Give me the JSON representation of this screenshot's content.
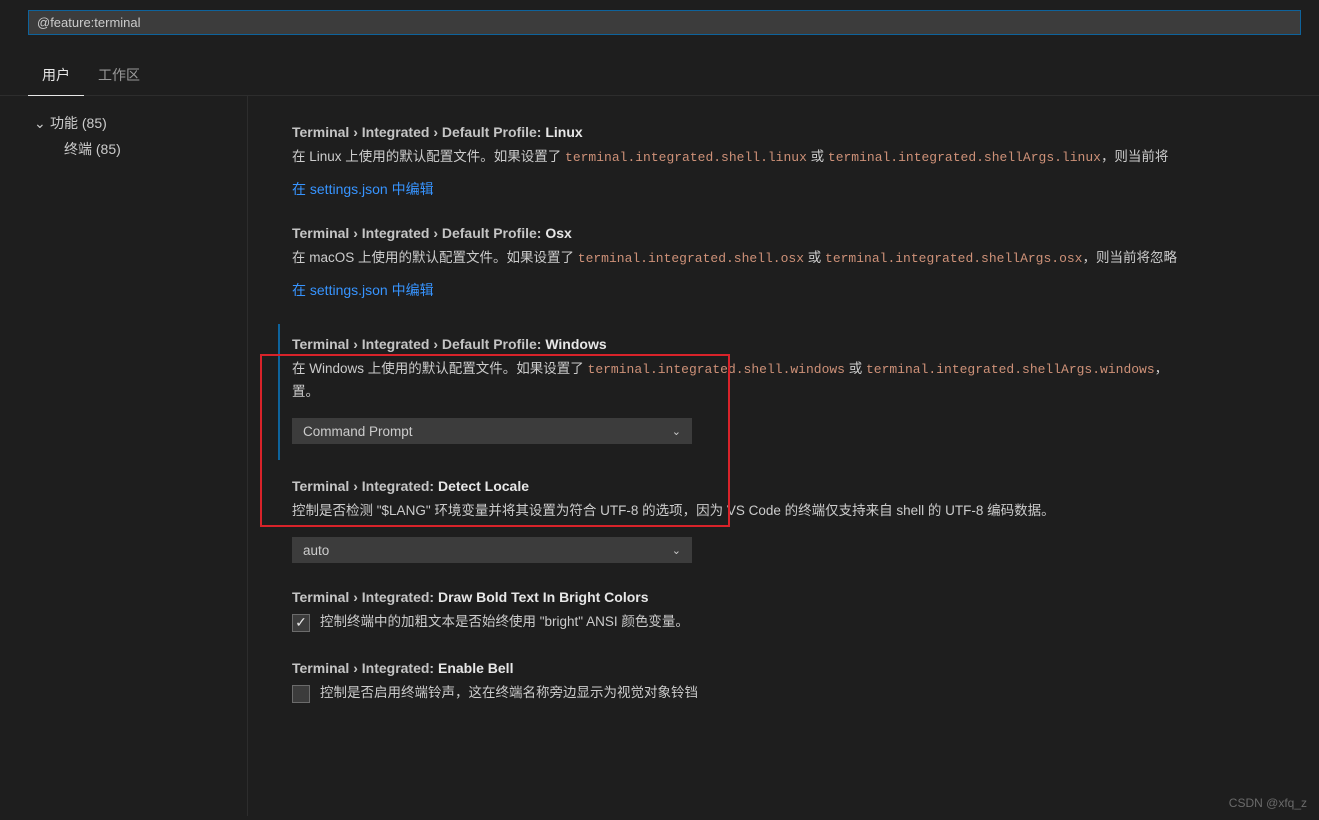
{
  "search": {
    "value": "@feature:terminal"
  },
  "tabs": {
    "user": "用户",
    "workspace": "工作区"
  },
  "sidebar": {
    "features": "功能 (85)",
    "terminal": "终端 (85)"
  },
  "settings": {
    "linux": {
      "path": "Terminal › Integrated › Default Profile: ",
      "last": "Linux",
      "desc1": "在 Linux 上使用的默认配置文件。如果设置了 ",
      "code1": "terminal.integrated.shell.linux",
      "or": " 或 ",
      "code2": "terminal.integrated.shellArgs.linux",
      "tail": "，则当前将",
      "edit": "在 settings.json 中编辑"
    },
    "osx": {
      "path": "Terminal › Integrated › Default Profile: ",
      "last": "Osx",
      "desc1": "在 macOS 上使用的默认配置文件。如果设置了 ",
      "code1": "terminal.integrated.shell.osx",
      "or": " 或 ",
      "code2": "terminal.integrated.shellArgs.osx",
      "tail": "，则当前将忽略",
      "edit": "在 settings.json 中编辑"
    },
    "windows": {
      "path": "Terminal › Integrated › Default Profile: ",
      "last": "Windows",
      "desc1": "在 Windows 上使用的默认配置文件。如果设置了 ",
      "code1": "terminal.integrated.shell.windows",
      "or": " 或 ",
      "code2": "terminal.integrated.shellArgs.windows",
      "tail": "，",
      "desc2": "置。",
      "select": "Command Prompt"
    },
    "detectLocale": {
      "path": "Terminal › Integrated: ",
      "last": "Detect Locale",
      "desc": "控制是否检测 \"$LANG\" 环境变量并将其设置为符合 UTF-8 的选项，因为 VS Code 的终端仅支持来自 shell 的 UTF-8 编码数据。",
      "select": "auto"
    },
    "drawBold": {
      "path": "Terminal › Integrated: ",
      "last": "Draw Bold Text In Bright Colors",
      "desc": "控制终端中的加粗文本是否始终使用 \"bright\" ANSI 颜色变量。",
      "checked": true
    },
    "enableBell": {
      "path": "Terminal › Integrated: ",
      "last": "Enable Bell",
      "desc": "控制是否启用终端铃声，这在终端名称旁边显示为视觉对象铃铛",
      "checked": false
    }
  },
  "watermark": "CSDN @xfq_z"
}
